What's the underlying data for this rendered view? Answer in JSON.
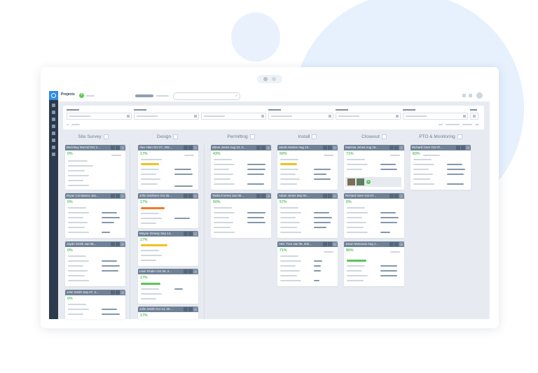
{
  "app": {
    "title": "Projects",
    "add_label": "+"
  },
  "columns": [
    {
      "name": "Site Survey"
    },
    {
      "name": "Design"
    },
    {
      "name": "Permitting"
    },
    {
      "name": "Install"
    },
    {
      "name": "Closeout"
    },
    {
      "name": "PTO & Monitoring"
    }
  ],
  "cards": {
    "c0_0": {
      "title": "Best Buy NorCal Oct 1...",
      "pct": "0%"
    },
    "c0_1": {
      "title": "Bryan Constance Jan...",
      "pct": "0%"
    },
    "c0_2": {
      "title": "Jayde Smith Jan 05...",
      "pct": "0%"
    },
    "c0_3": {
      "title": "John Smith Sep 07, 2...",
      "pct": "0%"
    },
    "c1_0": {
      "title": "Alex Hien Oct 27, 202...",
      "pct": "17%"
    },
    "c1_1": {
      "title": "John Smithers Oct 25...",
      "pct": "17%"
    },
    "c1_2": {
      "title": "Wayne Greasy Sep 14...",
      "pct": "17%"
    },
    "c1_3": {
      "title": "Liam Finder Oct 26, 2...",
      "pct": "17%"
    },
    "c1_4": {
      "title": "John Smith Oct 14, 20...",
      "pct": "17%"
    },
    "c2_0": {
      "title": "Steve Jones Aug 13, 2...",
      "pct": "43%"
    },
    "c2_1": {
      "title": "Tasha Forrest Jan 05...",
      "pct": "50%"
    },
    "c3_0": {
      "title": "Jacob Horsen Aug 13...",
      "pct": "50%"
    },
    "c3_1": {
      "title": "Adam Jones Sep 02...",
      "pct": "57%"
    },
    "c3_2": {
      "title": "ABC Tree Jan 05, 202...",
      "pct": "71%"
    },
    "c4_0": {
      "title": "Marissa Jones Aug 15...",
      "pct": "71%"
    },
    "c4_1": {
      "title": "Richard Gere Oct 07...",
      "pct": "0%"
    },
    "c4_2": {
      "title": "Jason Monsoon Aug 1...",
      "pct": "86%"
    },
    "c5_0": {
      "title": "Richard Gere Oct 07...",
      "pct": "83%"
    }
  },
  "colors": {
    "accent_blue": "#2f8be8",
    "sidebar": "#2b3a4d",
    "card_header": "#6f8196",
    "progress_green": "#58c45e",
    "bar_yellow": "#f2c11f",
    "bar_orange": "#f07a28",
    "bar_green": "#5bc45a"
  }
}
